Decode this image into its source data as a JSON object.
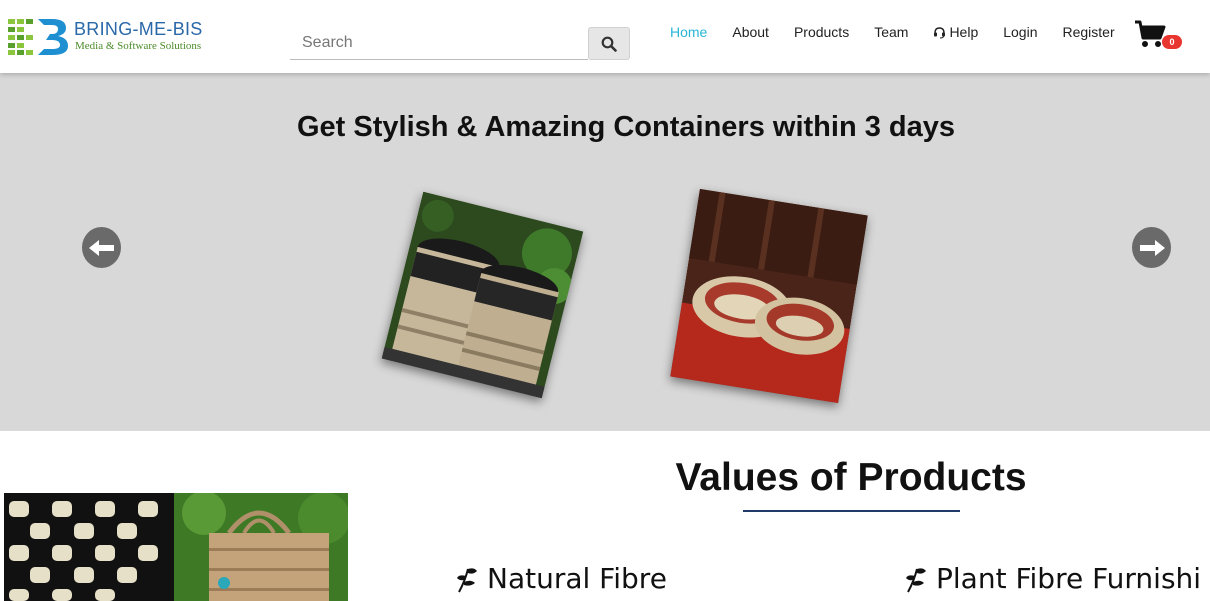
{
  "brand": {
    "name": "BRING-ME-BIS",
    "tagline": "Media & Software Solutions",
    "colors": {
      "primary": "#2a68a8",
      "green": "#8cc63f",
      "dark_green": "#4c8c2a"
    }
  },
  "search": {
    "placeholder": "Search",
    "value": "",
    "button_icon": "search-icon"
  },
  "nav": {
    "items": [
      {
        "label": "Home",
        "active": true
      },
      {
        "label": "About"
      },
      {
        "label": "Products"
      },
      {
        "label": "Team"
      },
      {
        "label": "Help",
        "icon": "headset-icon"
      },
      {
        "label": "Login"
      },
      {
        "label": "Register"
      }
    ],
    "active_color": "#29b6d6"
  },
  "cart": {
    "icon": "cart-icon",
    "count": "0"
  },
  "hero": {
    "title": "Get Stylish & Amazing Containers within 3 days",
    "background": "#d8d8d8",
    "prev_icon": "arrow-left-icon",
    "next_icon": "arrow-right-icon"
  },
  "values": {
    "title": "Values of Products",
    "items": [
      {
        "label": "Natural Fibre",
        "icon": "leaf-icon"
      },
      {
        "label": "Plant Fibre Furnishi",
        "icon": "leaf-icon"
      }
    ]
  }
}
